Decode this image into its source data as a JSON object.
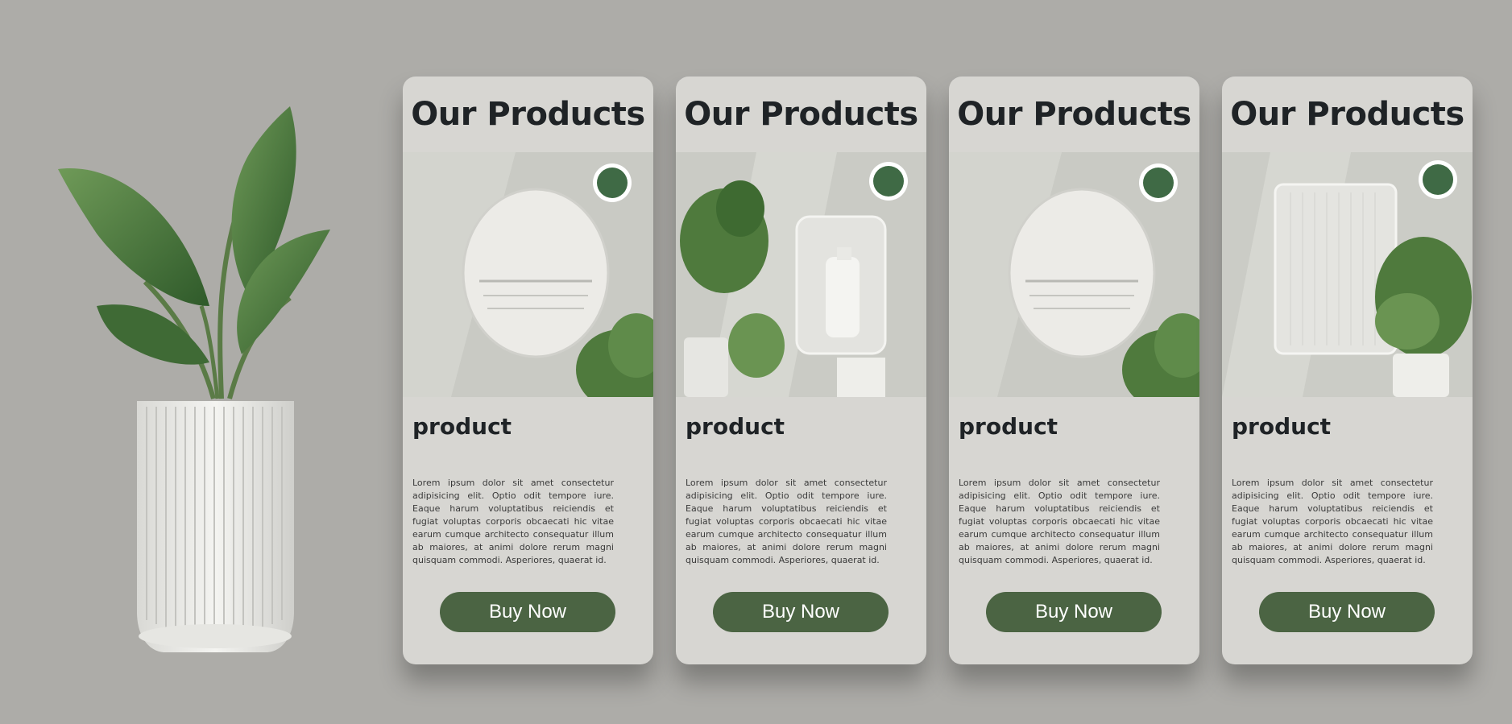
{
  "colors": {
    "background": "#adaca8",
    "card": "#d7d6d2",
    "accent": "#4b6443",
    "text": "#1f2326"
  },
  "cards": [
    {
      "title": "Our Products",
      "product_name": "product",
      "description": "Lorem ipsum dolor sit amet consectetur adipisicing elit. Optio odit tempore iure. Eaque harum voluptatibus reiciendis et fugiat voluptas corporis obcaecati hic vitae earum cumque architecto consequatur illum ab maiores, at animi dolore rerum magni quisquam commodi. Asperiores, quaerat id.",
      "button_label": "Buy Now",
      "image": "round-wall-panel-with-plant"
    },
    {
      "title": "Our Products",
      "product_name": "product",
      "description": "Lorem ipsum dolor sit amet consectetur adipisicing elit. Optio odit tempore iure. Eaque harum voluptatibus reiciendis et fugiat voluptas corporis obcaecati hic vitae earum cumque architecto consequatur illum ab maiores, at animi dolore rerum magni quisquam commodi. Asperiores, quaerat id.",
      "button_label": "Buy Now",
      "image": "dispenser-with-monstera"
    },
    {
      "title": "Our Products",
      "product_name": "product",
      "description": "Lorem ipsum dolor sit amet consectetur adipisicing elit. Optio odit tempore iure. Eaque harum voluptatibus reiciendis et fugiat voluptas corporis obcaecati hic vitae earum cumque architecto consequatur illum ab maiores, at animi dolore rerum magni quisquam commodi. Asperiores, quaerat id.",
      "button_label": "Buy Now",
      "image": "round-wall-panel-with-plant"
    },
    {
      "title": "Our Products",
      "product_name": "product",
      "description": "Lorem ipsum dolor sit amet consectetur adipisicing elit. Optio odit tempore iure. Eaque harum voluptatibus reiciendis et fugiat voluptas corporis obcaecati hic vitae earum cumque architecto consequatur illum ab maiores, at animi dolore rerum magni quisquam commodi. Asperiores, quaerat id.",
      "button_label": "Buy Now",
      "image": "square-wall-panel-with-plant"
    }
  ]
}
